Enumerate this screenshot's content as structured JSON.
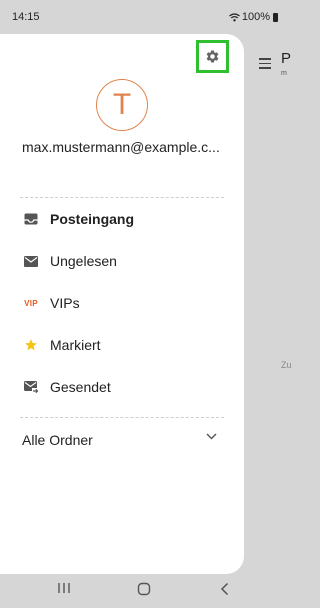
{
  "status_bar": {
    "time": "14:15",
    "battery": "100%"
  },
  "background_app": {
    "title_fragment": "P",
    "subtitle_fragment": "m",
    "hint_fragment": "Zu"
  },
  "drawer": {
    "avatar_letter": "T",
    "email": "max.mustermann@example.c...",
    "nav_items": [
      {
        "label": "Posteingang",
        "icon": "inbox-icon",
        "active": true
      },
      {
        "label": "Ungelesen",
        "icon": "envelope-icon"
      },
      {
        "label": "VIPs",
        "icon": "vip-icon",
        "icon_text": "VIP"
      },
      {
        "label": "Markiert",
        "icon": "star-icon"
      },
      {
        "label": "Gesendet",
        "icon": "sent-mail-icon"
      }
    ],
    "folders_label": "Alle Ordner"
  },
  "colors": {
    "highlight": "#2ec02e",
    "accent": "#e0834d",
    "vip": "#e8581f",
    "star": "#f5c518"
  }
}
